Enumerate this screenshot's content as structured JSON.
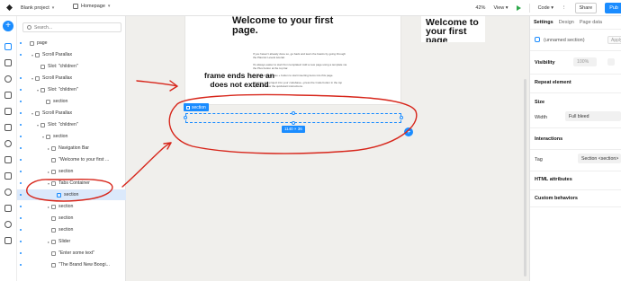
{
  "topbar": {
    "project": "Blank project",
    "page": "Homepage",
    "zoom": "42%",
    "view": "View",
    "code": "Code",
    "share": "Share",
    "publish": "Pub"
  },
  "leftpanel": {
    "search_placeholder": "Search...",
    "tree": [
      {
        "label": "page",
        "indent": 0,
        "dot": true,
        "chev": ""
      },
      {
        "label": "Scroll Parallax",
        "indent": 1,
        "dot": true,
        "chev": "▾"
      },
      {
        "label": "Slot: \"children\"",
        "indent": 2,
        "dot": false,
        "chev": ""
      },
      {
        "label": "Scroll Parallax",
        "indent": 1,
        "dot": true,
        "chev": "▾"
      },
      {
        "label": "Slot: \"children\"",
        "indent": 2,
        "dot": true,
        "chev": "▾"
      },
      {
        "label": "section",
        "indent": 3,
        "dot": true,
        "chev": ""
      },
      {
        "label": "Scroll Parallax",
        "indent": 1,
        "dot": true,
        "chev": "▾"
      },
      {
        "label": "Slot: \"children\"",
        "indent": 2,
        "dot": true,
        "chev": "▾"
      },
      {
        "label": "section",
        "indent": 3,
        "dot": true,
        "chev": "▾"
      },
      {
        "label": "Navigation Bar",
        "indent": 4,
        "dot": true,
        "chev": "▸"
      },
      {
        "label": "\"Welcome to your first ...",
        "indent": 4,
        "dot": true,
        "chev": ""
      },
      {
        "label": "section",
        "indent": 4,
        "dot": true,
        "chev": "▸"
      },
      {
        "label": "Tabs Container",
        "indent": 4,
        "dot": true,
        "chev": "▾"
      },
      {
        "label": "section",
        "indent": 5,
        "dot": true,
        "chev": "",
        "selected": true
      },
      {
        "label": "section",
        "indent": 4,
        "dot": true,
        "chev": "▸"
      },
      {
        "label": "section",
        "indent": 4,
        "dot": true,
        "chev": ""
      },
      {
        "label": "section",
        "indent": 4,
        "dot": true,
        "chev": ""
      },
      {
        "label": "Slider",
        "indent": 4,
        "dot": true,
        "chev": "▸"
      },
      {
        "label": "\"Enter some text\"",
        "indent": 4,
        "dot": true,
        "chev": ""
      },
      {
        "label": "\"The Brand New Boogi...",
        "indent": 4,
        "dot": true,
        "chev": ""
      }
    ]
  },
  "canvas": {
    "heading": "Welcome to your first page.",
    "heading2": "Welcome to your first page",
    "paragraphs": [
      "If you haven't already done so, go back and learn the basics by going through the Plasmic Levels tutorial.",
      "It's always easier to start from templates! Add a new page using a template via the Plus button at the top bar.",
      "Or press the big blue + button to start inserting items into this page.",
      "Integrate this project into your codebase—press the Code button in the top right and follow the quickstart instructions."
    ],
    "selected_tag": "section",
    "size_label": "1140 × 36",
    "annotation": "frame ends here an does not extend"
  },
  "rightpanel": {
    "tabs": [
      "Settings",
      "Design",
      "Page data"
    ],
    "active_tab": "Settings",
    "element_name": "(unnamed section)",
    "apply_btn": "Apply",
    "visibility_label": "Visibility",
    "visibility_value": "100%",
    "repeat_label": "Repeat element",
    "size_label": "Size",
    "width_label": "Width",
    "width_value": "Full bleed",
    "interactions_label": "Interactions",
    "tag_label": "Tag",
    "tag_value": "Section <section>",
    "html_attrs_label": "HTML attributes",
    "custom_label": "Custom behaviors"
  },
  "colors": {
    "accent": "#1a8cff",
    "annotation_red": "#d7261b",
    "selected_row": "#dbe9fb"
  }
}
